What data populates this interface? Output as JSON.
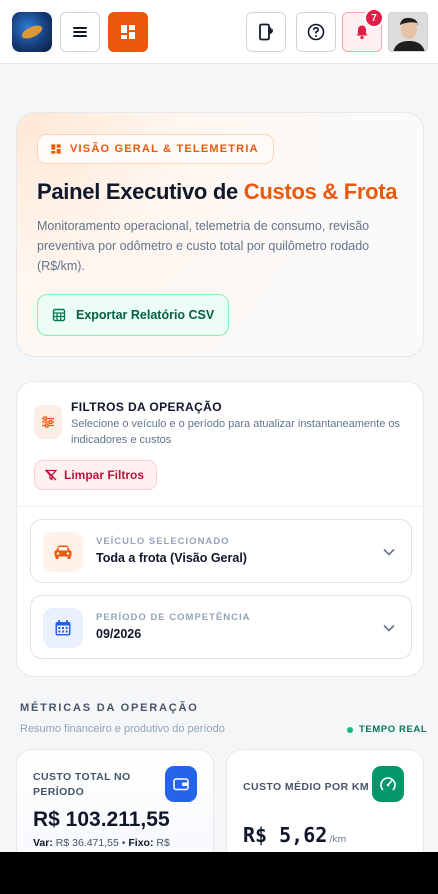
{
  "header": {
    "notifications_count": "7",
    "icons": [
      "app-logo",
      "menu-icon",
      "dashboard-icon",
      "install-app-icon",
      "help-icon",
      "bell-icon",
      "user-avatar"
    ]
  },
  "hero": {
    "tag": "VISÃO GERAL & TELEMETRIA",
    "title_main": "Painel Executivo de ",
    "title_accent": "Custos & Frota",
    "description": "Monitoramento operacional, telemetria de consumo, revisão preventiva por odômetro e custo total por quilômetro rodado (R$/km).",
    "export_label": "Exportar Relatório CSV"
  },
  "filters": {
    "title": "FILTROS DA OPERAÇÃO",
    "subtitle": "Selecione o veículo e o período para atualizar instantaneamente os indicadores e custos",
    "clear_label": "Limpar Filtros",
    "vehicle": {
      "label": "VEÍCULO SELECIONADO",
      "value": "Toda a frota (Visão Geral)"
    },
    "period": {
      "label": "PERÍODO DE COMPETÊNCIA",
      "value": "09/2026"
    }
  },
  "metrics": {
    "title": "MÉTRICAS DA OPERAÇÃO",
    "subtitle": "Resumo financeiro e produtivo do período",
    "live_label": "TEMPO REAL",
    "total_cost": {
      "label": "CUSTO TOTAL NO PERÍODO",
      "value": "R$ 103.211,55",
      "var_label": "Var:",
      "var_value": "R$ 36.471,55",
      "sep": "•",
      "fixed_label": "Fixo:",
      "fixed_value": "R$"
    },
    "avg_cost_km": {
      "label": "CUSTO MÉDIO POR KM",
      "value": "R$ 5,62",
      "unit": "/km"
    }
  },
  "colors": {
    "accent": "#ea580c",
    "success": "#047857",
    "danger": "#be123c",
    "primary": "#2563eb"
  }
}
